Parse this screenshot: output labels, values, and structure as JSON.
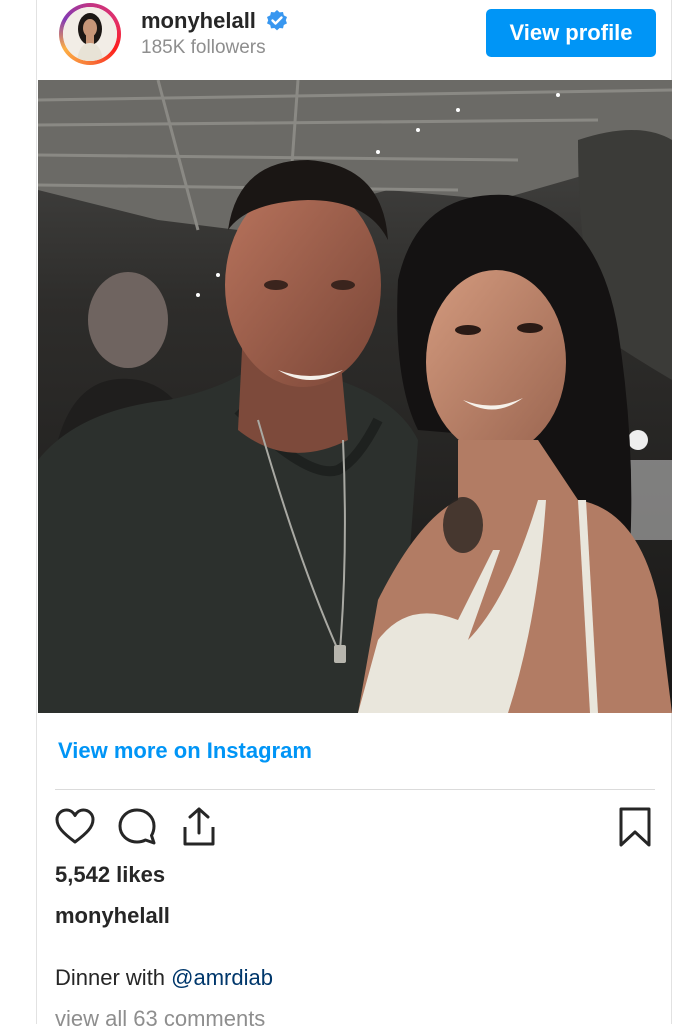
{
  "header": {
    "username": "monyhelall",
    "followers": "185K followers",
    "view_profile_label": "View profile"
  },
  "post": {
    "view_more_label": "View more on Instagram",
    "likes": "5,542 likes",
    "caption_user": "monyhelall",
    "caption_text": "Dinner with ",
    "caption_mention": "@amrdiab",
    "comments_link": "view all 63 comments"
  },
  "icons": {
    "verified": "verified-badge-icon",
    "like": "heart-icon",
    "comment": "comment-bubble-icon",
    "share": "share-icon",
    "save": "bookmark-icon"
  },
  "colors": {
    "accent": "#0095f6",
    "text": "#262626",
    "muted": "#8e8e8e",
    "mention": "#00376b"
  }
}
